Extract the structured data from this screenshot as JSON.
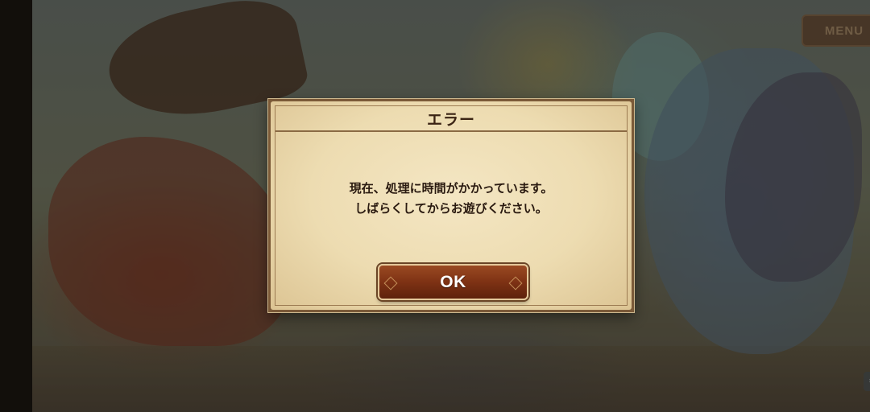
{
  "background": {
    "menu_button": {
      "label": "MENU",
      "icon": "menu-icon"
    },
    "corner_icon": "settings-icon"
  },
  "dialog": {
    "title": "エラー",
    "message_lines": [
      "現在、処理に時間がかかっています。",
      "しばらくしてからお遊びください。"
    ],
    "ok_button": {
      "label": "OK"
    }
  },
  "colors": {
    "dialog_paper": "#eddcb1",
    "dialog_border": "#7b5a38",
    "button_fill": "#7e3214",
    "button_text": "#ffffff",
    "text": "#2a1a10"
  }
}
